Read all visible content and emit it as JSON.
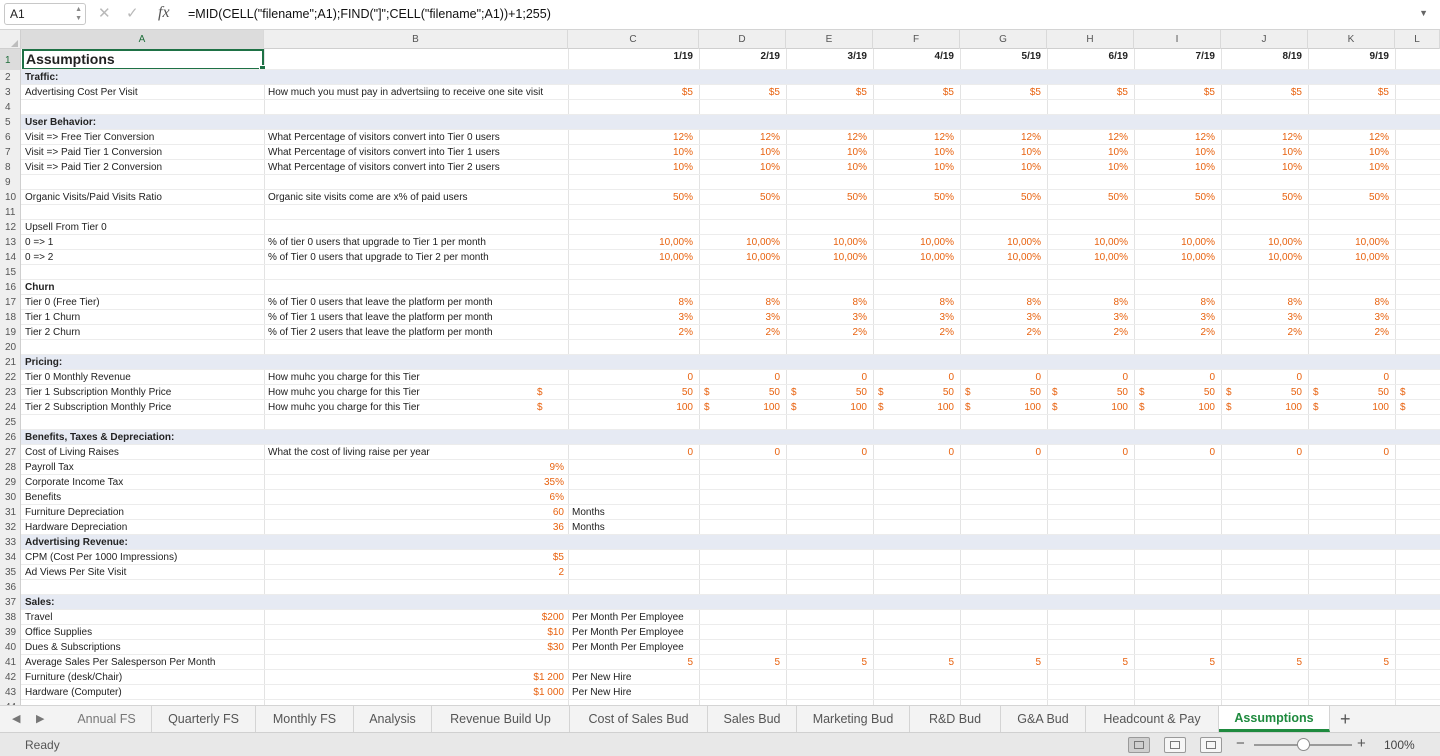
{
  "formula_bar": {
    "name_box": "A1",
    "cancel_glyph": "✕",
    "confirm_glyph": "✓",
    "fx_label": "fx",
    "formula": "=MID(CELL(\"filename\";A1);FIND(\"]\";CELL(\"filename\";A1))+1;255)"
  },
  "columns": [
    "A",
    "B",
    "C",
    "D",
    "E",
    "F",
    "G",
    "H",
    "I",
    "J",
    "K",
    "L"
  ],
  "months": [
    "1/19",
    "2/19",
    "3/19",
    "4/19",
    "5/19",
    "6/19",
    "7/19",
    "8/19",
    "9/19"
  ],
  "rows": [
    {
      "n": "1",
      "a": "Assumptions"
    },
    {
      "n": "2",
      "a": "Traffic:",
      "bold": true,
      "shaded": true
    },
    {
      "n": "3",
      "a": "Advertising Cost Per Visit",
      "b": "How much you must pay in advertsiing to receive one site visit",
      "m": [
        "$5",
        "$5",
        "$5",
        "$5",
        "$5",
        "$5",
        "$5",
        "$5",
        "$5"
      ]
    },
    {
      "n": "4"
    },
    {
      "n": "5",
      "a": "User Behavior:",
      "bold": true,
      "shaded": true
    },
    {
      "n": "6",
      "a": "Visit => Free Tier Conversion",
      "b": "What Percentage of visitors convert into Tier 0 users",
      "m": [
        "12%",
        "12%",
        "12%",
        "12%",
        "12%",
        "12%",
        "12%",
        "12%",
        "12%"
      ]
    },
    {
      "n": "7",
      "a": "Visit => Paid Tier 1 Conversion",
      "b": "What Percentage of visitors convert into Tier 1 users",
      "m": [
        "10%",
        "10%",
        "10%",
        "10%",
        "10%",
        "10%",
        "10%",
        "10%",
        "10%"
      ]
    },
    {
      "n": "8",
      "a": "Visit => Paid Tier 2 Conversion",
      "b": "What Percentage of visitors convert into Tier 2 users",
      "m": [
        "10%",
        "10%",
        "10%",
        "10%",
        "10%",
        "10%",
        "10%",
        "10%",
        "10%"
      ]
    },
    {
      "n": "9"
    },
    {
      "n": "10",
      "a": "Organic Visits/Paid Visits Ratio",
      "b": "Organic site visits come are x% of paid users",
      "m": [
        "50%",
        "50%",
        "50%",
        "50%",
        "50%",
        "50%",
        "50%",
        "50%",
        "50%"
      ]
    },
    {
      "n": "11"
    },
    {
      "n": "12",
      "a": "Upsell From Tier 0"
    },
    {
      "n": "13",
      "a": "0 => 1",
      "b": "% of tier 0 users that upgrade to Tier 1 per month",
      "m": [
        "10,00%",
        "10,00%",
        "10,00%",
        "10,00%",
        "10,00%",
        "10,00%",
        "10,00%",
        "10,00%",
        "10,00%"
      ]
    },
    {
      "n": "14",
      "a": "0 => 2",
      "b": "% of Tier 0 users that upgrade to Tier 2 per month",
      "m": [
        "10,00%",
        "10,00%",
        "10,00%",
        "10,00%",
        "10,00%",
        "10,00%",
        "10,00%",
        "10,00%",
        "10,00%"
      ]
    },
    {
      "n": "15"
    },
    {
      "n": "16",
      "a": "Churn",
      "bold": true
    },
    {
      "n": "17",
      "a": "Tier 0 (Free Tier)",
      "b": "% of Tier 0 users that leave the platform per month",
      "m": [
        "8%",
        "8%",
        "8%",
        "8%",
        "8%",
        "8%",
        "8%",
        "8%",
        "8%"
      ]
    },
    {
      "n": "18",
      "a": "Tier 1 Churn",
      "b": "% of Tier 1 users that leave the platform per month",
      "m": [
        "3%",
        "3%",
        "3%",
        "3%",
        "3%",
        "3%",
        "3%",
        "3%",
        "3%"
      ]
    },
    {
      "n": "19",
      "a": "Tier 2 Churn",
      "b": "% of Tier 2 users that leave the platform per month",
      "m": [
        "2%",
        "2%",
        "2%",
        "2%",
        "2%",
        "2%",
        "2%",
        "2%",
        "2%"
      ]
    },
    {
      "n": "20"
    },
    {
      "n": "21",
      "a": "Pricing:",
      "bold": true,
      "shaded": true
    },
    {
      "n": "22",
      "a": "Tier 0 Monthly Revenue",
      "b": "How muhc you charge for this Tier",
      "m": [
        "0",
        "0",
        "0",
        "0",
        "0",
        "0",
        "0",
        "0",
        "0"
      ]
    },
    {
      "n": "23",
      "a": "Tier 1 Subscription Monthly Price",
      "b": "How muhc you charge for this Tier",
      "c": "$",
      "m": [
        "50",
        "50",
        "50",
        "50",
        "50",
        "50",
        "50",
        "50",
        "50"
      ],
      "dollars": true
    },
    {
      "n": "24",
      "a": "Tier 2 Subscription Monthly Price",
      "b": "How muhc you charge for this Tier",
      "c": "$",
      "m": [
        "100",
        "100",
        "100",
        "100",
        "100",
        "100",
        "100",
        "100",
        "100"
      ],
      "dollars": true
    },
    {
      "n": "25"
    },
    {
      "n": "26",
      "a": "Benefits, Taxes & Depreciation:",
      "bold": true,
      "shaded": true
    },
    {
      "n": "27",
      "a": "Cost of Living Raises",
      "b": "What the cost of living raise per year",
      "m": [
        "0",
        "0",
        "0",
        "0",
        "0",
        "0",
        "0",
        "0",
        "0"
      ]
    },
    {
      "n": "28",
      "a": "Payroll Tax",
      "bv": "9%"
    },
    {
      "n": "29",
      "a": "Corporate Income Tax",
      "bv": "35%"
    },
    {
      "n": "30",
      "a": "Benefits",
      "bv": "6%"
    },
    {
      "n": "31",
      "a": "Furniture Depreciation",
      "bv": "60",
      "c": "Months"
    },
    {
      "n": "32",
      "a": "Hardware Depreciation",
      "bv": "36",
      "c": "Months"
    },
    {
      "n": "33",
      "a": "Advertising Revenue:",
      "bold": true,
      "shaded": true
    },
    {
      "n": "34",
      "a": " CPM (Cost Per 1000 Impressions)",
      "bv": "$5"
    },
    {
      "n": "35",
      "a": "Ad Views Per Site Visit",
      "bv": "2"
    },
    {
      "n": "36"
    },
    {
      "n": "37",
      "a": "Sales:",
      "bold": true,
      "shaded": true
    },
    {
      "n": "38",
      "a": "Travel",
      "bv": "$200",
      "c": "Per Month Per Employee"
    },
    {
      "n": "39",
      "a": "Office Supplies",
      "bv": "$10",
      "c": "Per Month Per Employee"
    },
    {
      "n": "40",
      "a": "Dues & Subscriptions",
      "bv": "$30",
      "c": "Per Month Per Employee"
    },
    {
      "n": "41",
      "a": "Average Sales Per Salesperson Per Month",
      "m": [
        "5",
        "5",
        "5",
        "5",
        "5",
        "5",
        "5",
        "5",
        "5"
      ],
      "mshift": true
    },
    {
      "n": "42",
      "a": "Furniture (desk/Chair)",
      "bv": "$1 200",
      "c": "Per New Hire"
    },
    {
      "n": "43",
      "a": "Hardware (Computer)",
      "bv": "$1 000",
      "c": "Per New Hire"
    },
    {
      "n": "44"
    }
  ],
  "tabs": [
    "Annual FS",
    "Quarterly FS",
    "Monthly FS",
    "Analysis",
    "Revenue Build Up",
    "Cost of Sales Bud",
    "Sales Bud",
    "Marketing Bud",
    "R&D Bud",
    "G&A Bud",
    "Headcount & Pay",
    "Assumptions"
  ],
  "active_tab": "Assumptions",
  "add_tab": "+",
  "status": {
    "text": "Ready",
    "zoom": "100%",
    "zoom_minus": "−",
    "zoom_plus": "+"
  },
  "colors": {
    "accent": "#1e8a3e",
    "value_orange": "#e8620f",
    "section_fill": "#e6eaf3"
  }
}
